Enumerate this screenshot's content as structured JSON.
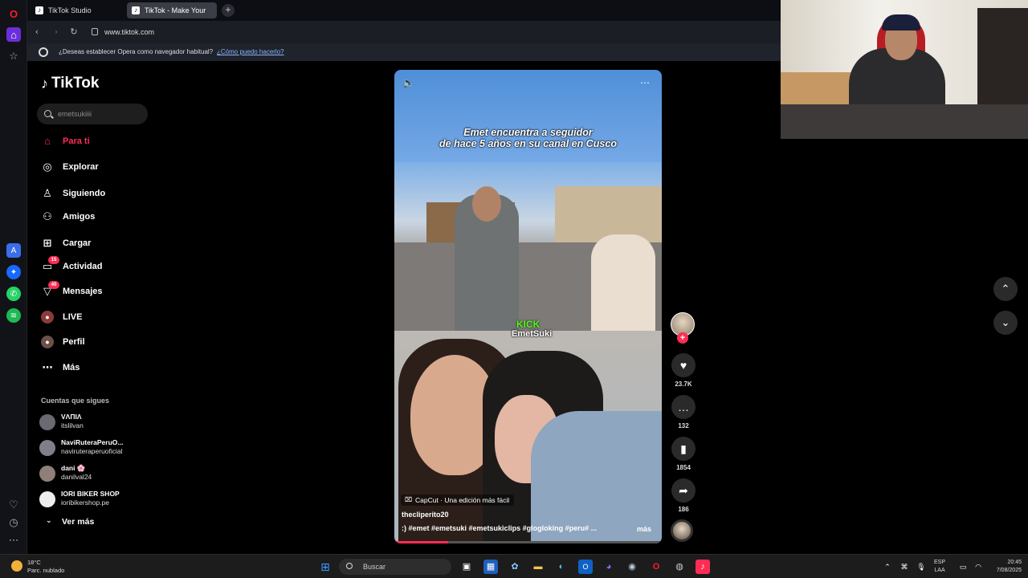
{
  "browser": {
    "tabs": [
      {
        "label": "TikTok Studio"
      },
      {
        "label": "TikTok - Make Your Day"
      }
    ],
    "url": "www.tiktok.com",
    "infobar_message": "¿Deseas establecer Opera como navegador habitual?",
    "infobar_link": "¿Cómo puedo hacerlo?"
  },
  "tiktok": {
    "logo": "TikTok",
    "search_value": "emetsukiiii",
    "nav": [
      {
        "label": "Para ti",
        "icon": "home-icon",
        "badge": ""
      },
      {
        "label": "Explorar",
        "icon": "compass-icon",
        "badge": ""
      },
      {
        "label": "Siguiendo",
        "icon": "following-icon",
        "badge": ""
      },
      {
        "label": "Amigos",
        "icon": "friends-icon",
        "badge": ""
      },
      {
        "label": "Cargar",
        "icon": "upload-icon",
        "badge": ""
      },
      {
        "label": "Actividad",
        "icon": "activity-icon",
        "badge": "15"
      },
      {
        "label": "Mensajes",
        "icon": "messages-icon",
        "badge": "40"
      },
      {
        "label": "LIVE",
        "icon": "live-icon",
        "badge": ""
      },
      {
        "label": "Perfil",
        "icon": "profile-icon",
        "badge": ""
      },
      {
        "label": "Más",
        "icon": "more-icon",
        "badge": ""
      }
    ],
    "following_title": "Cuentas que sigues",
    "following": [
      {
        "name": "VΛΠIΛ",
        "handle": "itslilvan"
      },
      {
        "name": "NaviRuteraPeruO...",
        "handle": "naviruteraperuoficial"
      },
      {
        "name": "dani 🌸",
        "handle": "danilval24"
      },
      {
        "name": "IORI BIKER SHOP",
        "handle": "ioribikershop.pe"
      }
    ],
    "see_more": "Ver más",
    "video": {
      "caption_line1": "Emet encuentra a seguidor",
      "caption_line2": "de hace 5 años en su canal en Cusco",
      "kick_label": "KICK",
      "kick_name": "EmetSuki",
      "capcut": "CapCut · Una edición más fácil",
      "author": "thecliperito20",
      "tags": ":) #emet #emetsuki #emetsukiclips #glogloking #peru# ...",
      "more": "más",
      "progress": 0.2
    },
    "actions": {
      "likes": "23.7K",
      "comments": "132",
      "saves": "1854",
      "shares": "186"
    }
  },
  "taskbar": {
    "weather_temp": "18°C",
    "weather_desc": "Parc. nublado",
    "search_placeholder": "Buscar",
    "lang1": "ESP",
    "lang2": "LAA",
    "time": "20:45",
    "date": "7/08/2025"
  },
  "colors": {
    "accent": "#fe2c55",
    "kick_green": "#53fc18"
  }
}
